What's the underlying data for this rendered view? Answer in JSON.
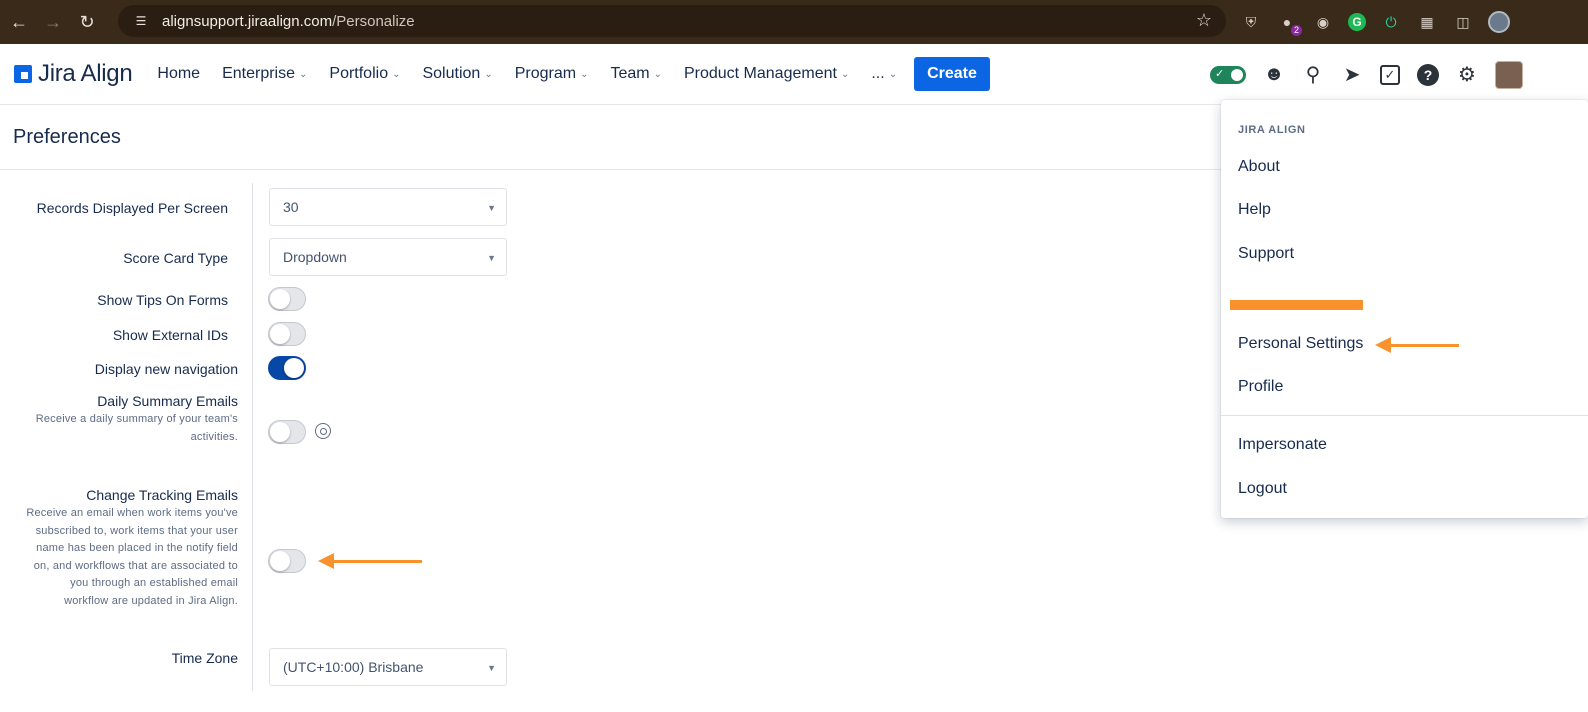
{
  "browser": {
    "url_host": "alignsupport.jiraalign.com",
    "url_path": "/Personalize",
    "ext_badge_count": "2",
    "ext_g_letter": "G"
  },
  "nav": {
    "logo_text": "Jira Align",
    "items": [
      "Home",
      "Enterprise",
      "Portfolio",
      "Solution",
      "Program",
      "Team",
      "Product Management",
      "..."
    ],
    "create_label": "Create"
  },
  "page": {
    "title": "Preferences"
  },
  "form": {
    "records_label": "Records Displayed Per Screen",
    "records_value": "30",
    "scorecard_label": "Score Card Type",
    "scorecard_value": "Dropdown",
    "tips_label": "Show Tips On Forms",
    "tips_on": false,
    "external_ids_label": "Show External IDs",
    "external_ids_on": false,
    "new_nav_label": "Display new navigation",
    "new_nav_on": true,
    "daily_label": "Daily Summary Emails",
    "daily_desc_1": "Receive a daily summary of your team's",
    "daily_desc_2": "activities.",
    "daily_on": false,
    "change_label": "Change Tracking Emails",
    "change_desc": [
      "Receive an email when work items you've",
      "subscribed to, work items that your user",
      "name has been placed in the notify field",
      "on, and workflows that are associated to",
      "you through an established email",
      "workflow are updated in Jira Align."
    ],
    "change_on": false,
    "timezone_label": "Time Zone",
    "timezone_value": "(UTC+10:00) Brisbane"
  },
  "menu": {
    "section": "JIRA ALIGN",
    "items": [
      "About",
      "Help",
      "Support",
      "Personal Settings",
      "Profile",
      "Impersonate",
      "Logout"
    ]
  },
  "colors": {
    "accent": "#0c66e4",
    "annotation": "#f7922d",
    "browser_bar": "#3a2a1a"
  }
}
